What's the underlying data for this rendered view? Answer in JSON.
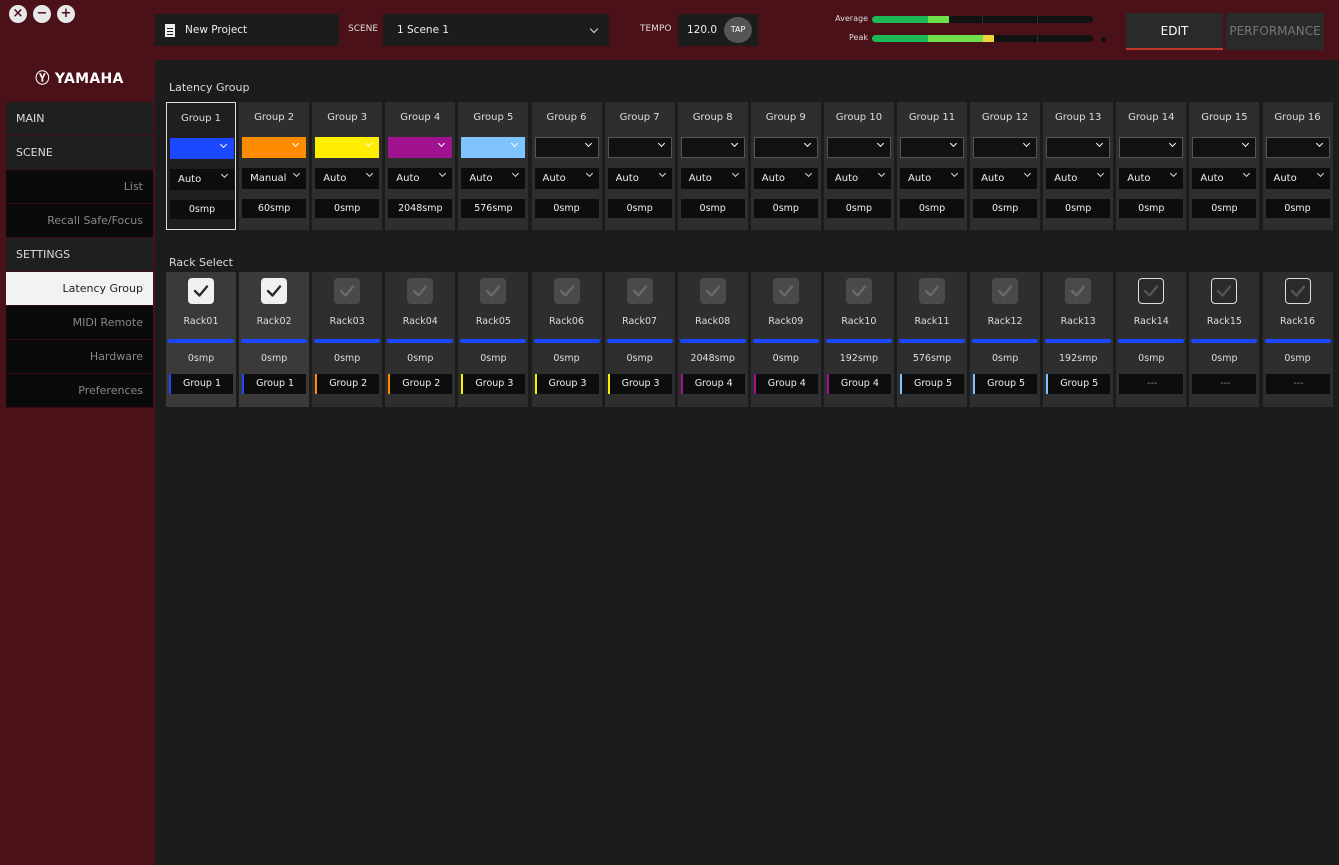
{
  "window_controls": [
    {
      "name": "close",
      "glyph": "✕"
    },
    {
      "name": "minimize",
      "glyph": "−"
    },
    {
      "name": "maximize",
      "glyph": "+"
    }
  ],
  "header": {
    "project_name": "New Project",
    "scene_label": "SCENE",
    "scene_value": "1  Scene 1",
    "tempo_label": "TEMPO",
    "tempo_value": "120.0",
    "tap_label": "TAP",
    "meter_average_label": "Average",
    "meter_peak_label": "Peak",
    "edit_label": "EDIT",
    "performance_label": "PERFORMANCE"
  },
  "sidebar": {
    "logo": "Ⓨ YAMAHA",
    "items": [
      {
        "label": "MAIN",
        "kind": "head"
      },
      {
        "label": "SCENE",
        "kind": "head"
      },
      {
        "label": "List",
        "kind": "sub"
      },
      {
        "label": "Recall Safe/Focus",
        "kind": "sub"
      },
      {
        "label": "SETTINGS",
        "kind": "head"
      },
      {
        "label": "Latency Group",
        "kind": "selected"
      },
      {
        "label": "MIDI Remote",
        "kind": "sub"
      },
      {
        "label": "Hardware",
        "kind": "sub"
      },
      {
        "label": "Preferences",
        "kind": "sub"
      }
    ]
  },
  "latency_group": {
    "title": "Latency Group",
    "groups": [
      {
        "name": "Group 1",
        "color": "#1a47ff",
        "mode": "Auto",
        "latency": "0smp"
      },
      {
        "name": "Group 2",
        "color": "#ff8c00",
        "mode": "Manual",
        "latency": "60smp"
      },
      {
        "name": "Group 3",
        "color": "#ffee00",
        "mode": "Auto",
        "latency": "0smp"
      },
      {
        "name": "Group 4",
        "color": "#a0128f",
        "mode": "Auto",
        "latency": "2048smp"
      },
      {
        "name": "Group 5",
        "color": "#7fc4ff",
        "mode": "Auto",
        "latency": "576smp"
      },
      {
        "name": "Group 6",
        "color": "",
        "mode": "Auto",
        "latency": "0smp"
      },
      {
        "name": "Group 7",
        "color": "",
        "mode": "Auto",
        "latency": "0smp"
      },
      {
        "name": "Group 8",
        "color": "",
        "mode": "Auto",
        "latency": "0smp"
      },
      {
        "name": "Group 9",
        "color": "",
        "mode": "Auto",
        "latency": "0smp"
      },
      {
        "name": "Group 10",
        "color": "",
        "mode": "Auto",
        "latency": "0smp"
      },
      {
        "name": "Group 11",
        "color": "",
        "mode": "Auto",
        "latency": "0smp"
      },
      {
        "name": "Group 12",
        "color": "",
        "mode": "Auto",
        "latency": "0smp"
      },
      {
        "name": "Group 13",
        "color": "",
        "mode": "Auto",
        "latency": "0smp"
      },
      {
        "name": "Group 14",
        "color": "",
        "mode": "Auto",
        "latency": "0smp"
      },
      {
        "name": "Group 15",
        "color": "",
        "mode": "Auto",
        "latency": "0smp"
      },
      {
        "name": "Group 16",
        "color": "",
        "mode": "Auto",
        "latency": "0smp"
      }
    ]
  },
  "rack_select": {
    "title": "Rack Select",
    "racks": [
      {
        "name": "Rack01",
        "state": "checked",
        "latency": "0smp",
        "group": "Group 1",
        "group_color": "#1a47ff"
      },
      {
        "name": "Rack02",
        "state": "checked",
        "latency": "0smp",
        "group": "Group 1",
        "group_color": "#1a47ff"
      },
      {
        "name": "Rack03",
        "state": "disabled",
        "latency": "0smp",
        "group": "Group 2",
        "group_color": "#ff8c00"
      },
      {
        "name": "Rack04",
        "state": "disabled",
        "latency": "0smp",
        "group": "Group 2",
        "group_color": "#ff8c00"
      },
      {
        "name": "Rack05",
        "state": "disabled",
        "latency": "0smp",
        "group": "Group 3",
        "group_color": "#ffee00"
      },
      {
        "name": "Rack06",
        "state": "disabled",
        "latency": "0smp",
        "group": "Group 3",
        "group_color": "#ffee00"
      },
      {
        "name": "Rack07",
        "state": "disabled",
        "latency": "0smp",
        "group": "Group 3",
        "group_color": "#ffee00"
      },
      {
        "name": "Rack08",
        "state": "disabled",
        "latency": "2048smp",
        "group": "Group 4",
        "group_color": "#a0128f"
      },
      {
        "name": "Rack09",
        "state": "disabled",
        "latency": "0smp",
        "group": "Group 4",
        "group_color": "#a0128f"
      },
      {
        "name": "Rack10",
        "state": "disabled",
        "latency": "192smp",
        "group": "Group 4",
        "group_color": "#a0128f"
      },
      {
        "name": "Rack11",
        "state": "disabled",
        "latency": "576smp",
        "group": "Group 5",
        "group_color": "#7fc4ff"
      },
      {
        "name": "Rack12",
        "state": "disabled",
        "latency": "0smp",
        "group": "Group 5",
        "group_color": "#7fc4ff"
      },
      {
        "name": "Rack13",
        "state": "disabled",
        "latency": "192smp",
        "group": "Group 5",
        "group_color": "#7fc4ff"
      },
      {
        "name": "Rack14",
        "state": "off",
        "latency": "0smp",
        "group": "---",
        "group_color": ""
      },
      {
        "name": "Rack15",
        "state": "off",
        "latency": "0smp",
        "group": "---",
        "group_color": ""
      },
      {
        "name": "Rack16",
        "state": "off",
        "latency": "0smp",
        "group": "---",
        "group_color": ""
      }
    ]
  },
  "colors": {
    "accent_edit_underline": "#c0392b",
    "meter_green": "#1db954",
    "meter_light_green": "#6ee04a",
    "meter_yellow": "#f2d23b"
  }
}
